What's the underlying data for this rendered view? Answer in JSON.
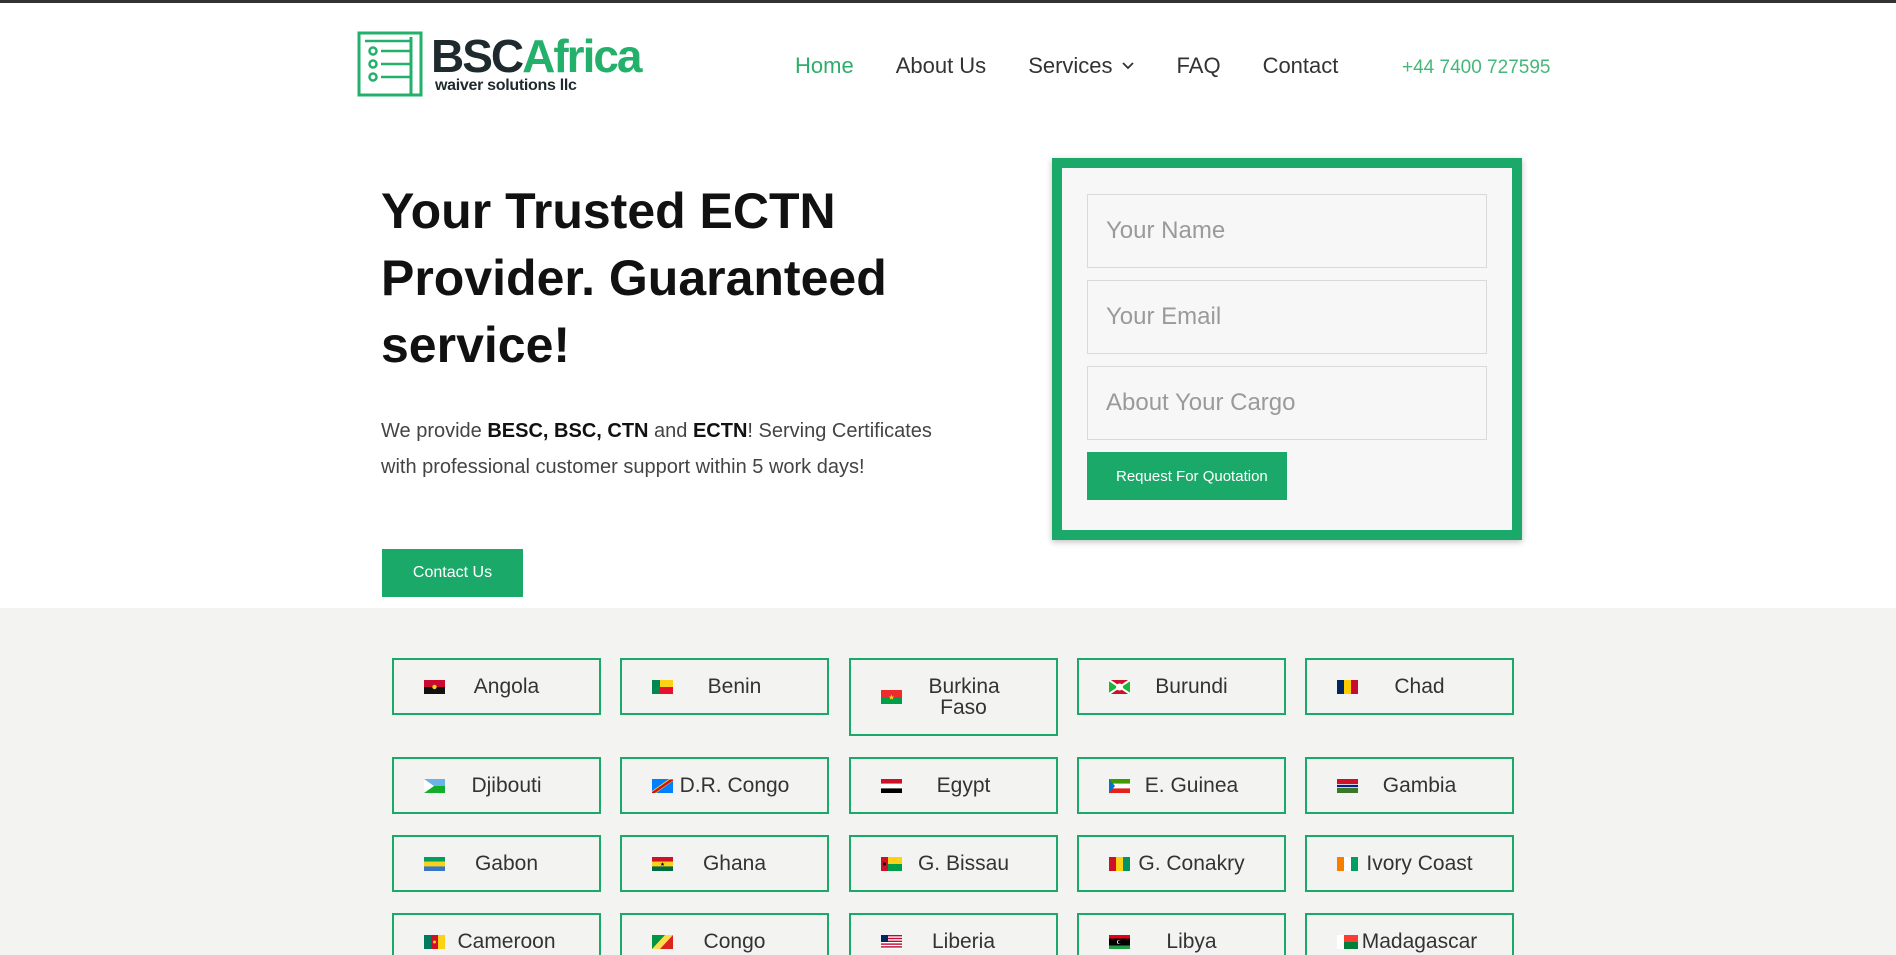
{
  "header": {
    "logo": {
      "brand_dark": "BSC",
      "brand_green": "Africa",
      "subtitle": "waiver solutions llc"
    },
    "nav": [
      {
        "label": "Home",
        "active": true
      },
      {
        "label": "About Us",
        "active": false
      },
      {
        "label": "Services",
        "active": false,
        "has_dropdown": true
      },
      {
        "label": "FAQ",
        "active": false
      },
      {
        "label": "Contact",
        "active": false
      }
    ],
    "phone": "+44 7400 727595"
  },
  "hero": {
    "title": "Your Trusted ECTN Provider. Guaranteed service!",
    "desc_prefix": "We provide ",
    "desc_bold1": "BESC, BSC, CTN",
    "desc_and": " and ",
    "desc_bold2": "ECTN",
    "desc_suffix": "! Serving Certificates with professional customer support within 5 work days!",
    "contact_button": "Contact Us"
  },
  "form": {
    "name_placeholder": "Your Name",
    "email_placeholder": "Your Email",
    "cargo_placeholder": "About Your Cargo",
    "submit_label": "Request For Quotation"
  },
  "colors": {
    "accent": "#1ba96a",
    "nav_active": "#2fae6b",
    "phone": "#46b77a",
    "section_bg": "#f3f4f2"
  },
  "countries": [
    {
      "name": "Angola",
      "flag": "angola-flag"
    },
    {
      "name": "Benin",
      "flag": "benin-flag"
    },
    {
      "name": "Burkina Faso",
      "flag": "burkina-faso-flag"
    },
    {
      "name": "Burundi",
      "flag": "burundi-flag"
    },
    {
      "name": "Chad",
      "flag": "chad-flag"
    },
    {
      "name": "Djibouti",
      "flag": "djibouti-flag"
    },
    {
      "name": "D.R. Congo",
      "flag": "dr-congo-flag"
    },
    {
      "name": "Egypt",
      "flag": "egypt-flag"
    },
    {
      "name": "E. Guinea",
      "flag": "e-guinea-flag"
    },
    {
      "name": "Gambia",
      "flag": "gambia-flag"
    },
    {
      "name": "Gabon",
      "flag": "gabon-flag"
    },
    {
      "name": "Ghana",
      "flag": "ghana-flag"
    },
    {
      "name": "G. Bissau",
      "flag": "g-bissau-flag"
    },
    {
      "name": "G. Conakry",
      "flag": "g-conakry-flag"
    },
    {
      "name": "Ivory Coast",
      "flag": "ivory-coast-flag"
    },
    {
      "name": "Cameroon",
      "flag": "cameroon-flag"
    },
    {
      "name": "Congo",
      "flag": "congo-flag"
    },
    {
      "name": "Liberia",
      "flag": "liberia-flag"
    },
    {
      "name": "Libya",
      "flag": "libya-flag"
    },
    {
      "name": "Madagascar",
      "flag": "madagascar-flag"
    }
  ]
}
